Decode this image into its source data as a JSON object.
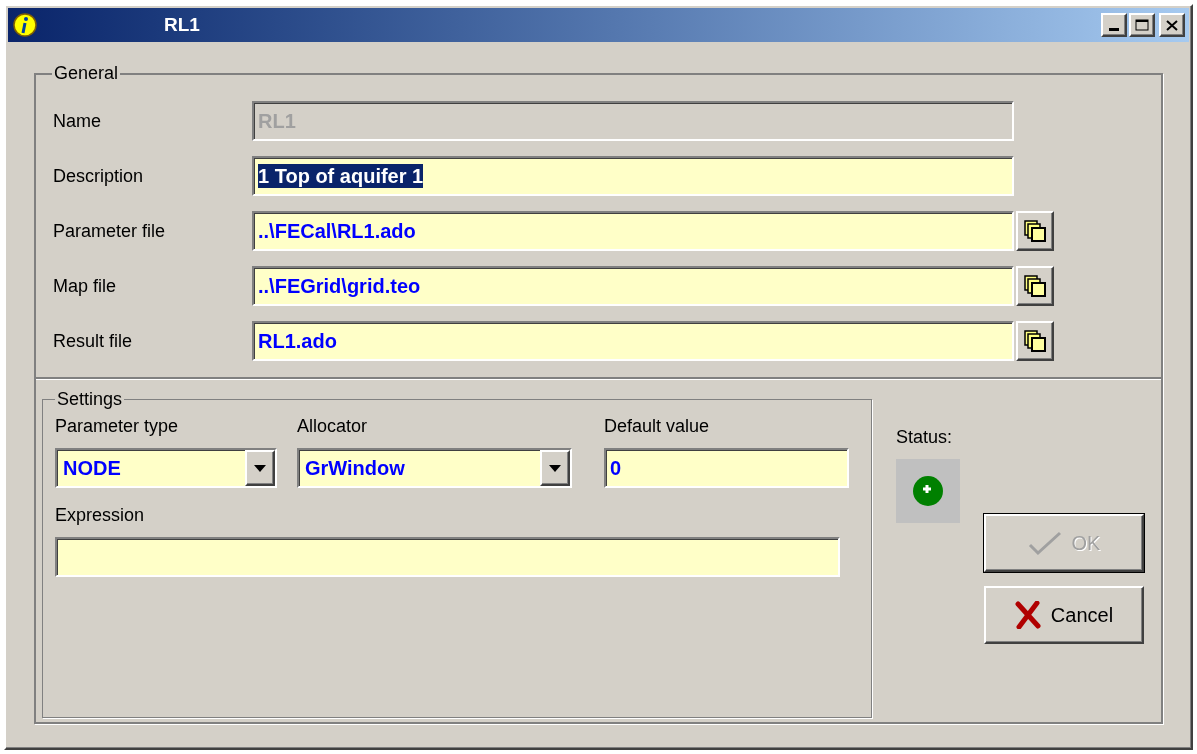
{
  "window": {
    "title": "RL1"
  },
  "general": {
    "legend": "General",
    "fields": [
      {
        "label": "Name",
        "value": "RL1",
        "disabled": true,
        "highlighted": false,
        "browse": false
      },
      {
        "label": "Description",
        "value": "1 Top of aquifer 1",
        "disabled": false,
        "highlighted": true,
        "browse": false
      },
      {
        "label": "Parameter file",
        "value": "..\\FECal\\RL1.ado",
        "disabled": false,
        "highlighted": false,
        "browse": true
      },
      {
        "label": "Map file",
        "value": "..\\FEGrid\\grid.teo",
        "disabled": false,
        "highlighted": false,
        "browse": true
      },
      {
        "label": "Result file",
        "value": "RL1.ado",
        "disabled": false,
        "highlighted": false,
        "browse": true
      }
    ]
  },
  "settings": {
    "legend": "Settings",
    "combos": [
      {
        "label": "Parameter type",
        "value": "NODE"
      },
      {
        "label": "Allocator",
        "value": "GrWindow"
      }
    ],
    "default_value": {
      "label": "Default value",
      "value": "0"
    },
    "expression": {
      "label": "Expression"
    }
  },
  "status": {
    "label": "Status:"
  },
  "buttons": [
    {
      "kind": "ok",
      "label": "OK",
      "disabled": true
    },
    {
      "kind": "cancel",
      "label": "Cancel",
      "disabled": false
    }
  ]
}
